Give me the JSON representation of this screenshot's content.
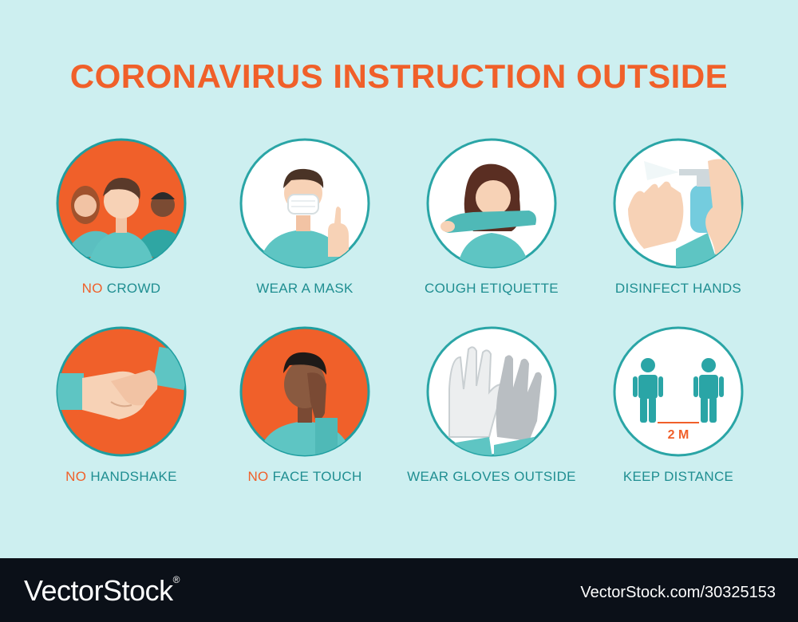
{
  "title": "CORONAVIRUS INSTRUCTION OUTSIDE",
  "items": [
    {
      "neg": "NO",
      "text": "CROWD",
      "icon": "crowd-icon"
    },
    {
      "neg": "",
      "text": "WEAR A MASK",
      "icon": "mask-icon"
    },
    {
      "neg": "",
      "text": "COUGH ETIQUETTE",
      "icon": "cough-icon"
    },
    {
      "neg": "",
      "text": "DISINFECT HANDS",
      "icon": "sanitizer-icon"
    },
    {
      "neg": "NO",
      "text": "HANDSHAKE",
      "icon": "handshake-icon"
    },
    {
      "neg": "NO",
      "text": "FACE TOUCH",
      "icon": "face-touch-icon"
    },
    {
      "neg": "",
      "text": "WEAR GLOVES OUTSIDE",
      "icon": "gloves-icon"
    },
    {
      "neg": "",
      "text": "KEEP DISTANCE",
      "icon": "distance-icon"
    }
  ],
  "distance_label": "2 M",
  "footer": {
    "brand": "VectorStock",
    "mark": "®",
    "credit": "VectorStock.com/30325153"
  },
  "colors": {
    "background": "#cdeff0",
    "accent": "#f0602a",
    "teal": "#1f8e91",
    "footer": "#0b1018"
  }
}
